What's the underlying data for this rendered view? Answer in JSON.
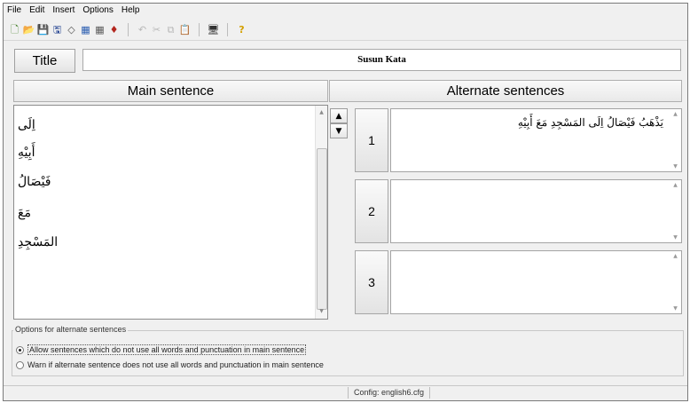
{
  "menu": [
    "File",
    "Edit",
    "Insert",
    "Options",
    "Help"
  ],
  "toolbar": {
    "icons": [
      {
        "name": "new-file-icon",
        "glyph": "🗋",
        "color": "#3b7a1f"
      },
      {
        "name": "open-folder-icon",
        "glyph": "📂",
        "color": "#c79b1f"
      },
      {
        "name": "save-icon",
        "glyph": "💾",
        "color": "#1f3f8f"
      },
      {
        "name": "save-as-icon",
        "glyph": "🖫",
        "color": "#1f3f8f"
      },
      {
        "name": "diamond-icon",
        "glyph": "◇",
        "color": "#555555"
      },
      {
        "name": "list-icon",
        "glyph": "▦",
        "color": "#2a5db0"
      },
      {
        "name": "grid-icon",
        "glyph": "▦",
        "color": "#5a5a5a"
      },
      {
        "name": "pin-icon",
        "glyph": "♦",
        "color": "#b3261e"
      }
    ],
    "edit_icons": [
      {
        "name": "undo-icon",
        "glyph": "↶"
      },
      {
        "name": "cut-icon",
        "glyph": "✂"
      },
      {
        "name": "copy-icon",
        "glyph": "⧉"
      },
      {
        "name": "paste-icon",
        "glyph": "📋"
      }
    ],
    "extra_icons": [
      {
        "name": "monitor-icon",
        "glyph": "🖥",
        "color": "#333333"
      },
      {
        "name": "help-icon",
        "glyph": "?",
        "color": "#d4a000"
      }
    ]
  },
  "title_button": "Title",
  "title_value": "Susun Kata",
  "headers": {
    "main": "Main sentence",
    "alternate": "Alternate sentences"
  },
  "main_words": [
    "اِلَى",
    "أَبِيْهِ",
    "فَيْصَالُ",
    "مَعَ",
    "المَسْجِدِ"
  ],
  "alt_rows": [
    {
      "number": "1",
      "text": "يَذْهَبُ فَيْصَالُ اِلَى المَسْجِدِ مَعَ أَبِيْهِ"
    },
    {
      "number": "2",
      "text": ""
    },
    {
      "number": "3",
      "text": ""
    }
  ],
  "options": {
    "legend": "Options for alternate sentences",
    "allow": "Allow sentences which do not use all words and punctuation in main sentence",
    "warn": "Warn if alternate sentence does not use all words and punctuation in main sentence",
    "selected": "allow"
  },
  "status": "Config: english6.cfg"
}
